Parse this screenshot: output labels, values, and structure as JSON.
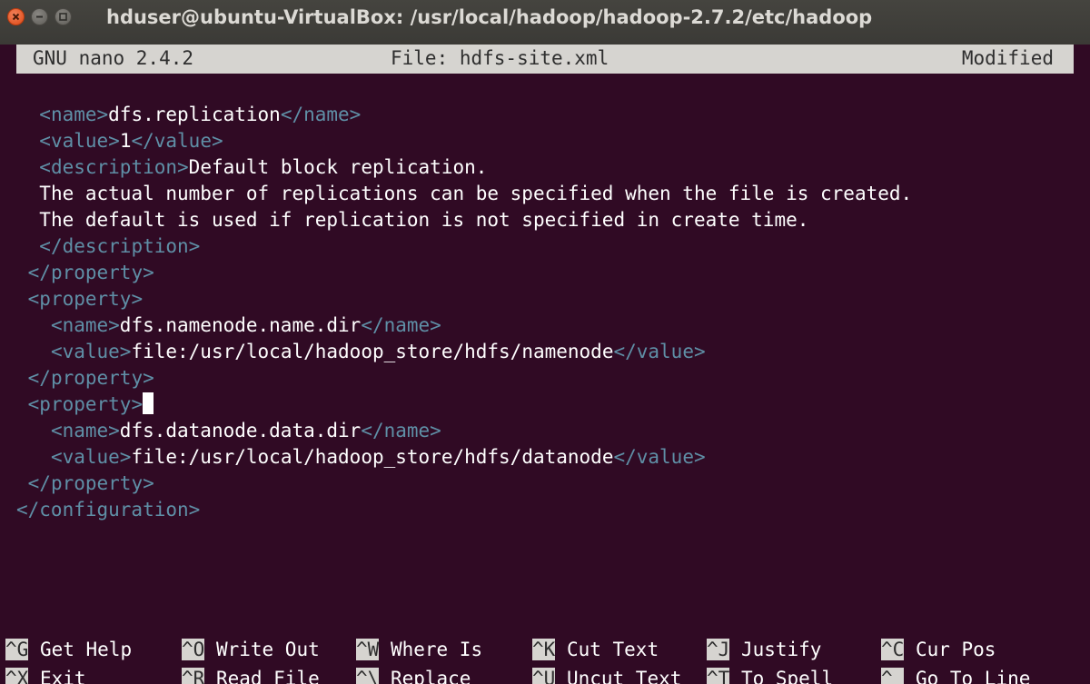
{
  "window": {
    "title": "hduser@ubuntu-VirtualBox: /usr/local/hadoop/hadoop-2.7.2/etc/hadoop"
  },
  "nano": {
    "version": "GNU nano 2.4.2",
    "file": "File: hdfs-site.xml",
    "status": "Modified"
  },
  "lines": [
    {
      "indent": "  ",
      "open": "<name>",
      "text": "dfs.replication",
      "close": "</name>"
    },
    {
      "indent": "  ",
      "open": "<value>",
      "text": "1",
      "close": "</value>"
    },
    {
      "indent": "  ",
      "open": "<description>",
      "text": "Default block replication.",
      "close": ""
    },
    {
      "indent": "  ",
      "open": "",
      "text": "The actual number of replications can be specified when the file is created.",
      "close": ""
    },
    {
      "indent": "  ",
      "open": "",
      "text": "The default is used if replication is not specified in create time.",
      "close": ""
    },
    {
      "indent": "  ",
      "open": "</description>",
      "text": "",
      "close": ""
    },
    {
      "indent": " ",
      "open": "</property>",
      "text": "",
      "close": ""
    },
    {
      "indent": " ",
      "open": "<property>",
      "text": "",
      "close": ""
    },
    {
      "indent": "   ",
      "open": "<name>",
      "text": "dfs.namenode.name.dir",
      "close": "</name>"
    },
    {
      "indent": "   ",
      "open": "<value>",
      "text": "file:/usr/local/hadoop_store/hdfs/namenode",
      "close": "</value>"
    },
    {
      "indent": " ",
      "open": "</property>",
      "text": "",
      "close": ""
    },
    {
      "indent": " ",
      "open": "<property>",
      "text": "",
      "close": "",
      "cursor": true
    },
    {
      "indent": "   ",
      "open": "<name>",
      "text": "dfs.datanode.data.dir",
      "close": "</name>"
    },
    {
      "indent": "   ",
      "open": "<value>",
      "text": "file:/usr/local/hadoop_store/hdfs/datanode",
      "close": "</value>"
    },
    {
      "indent": " ",
      "open": "</property>",
      "text": "",
      "close": ""
    },
    {
      "indent": "",
      "open": "</configuration>",
      "text": "",
      "close": ""
    }
  ],
  "shortcuts": [
    [
      {
        "key": "^G",
        "label": "Get Help"
      },
      {
        "key": "^O",
        "label": "Write Out"
      },
      {
        "key": "^W",
        "label": "Where Is"
      },
      {
        "key": "^K",
        "label": "Cut Text"
      },
      {
        "key": "^J",
        "label": "Justify"
      },
      {
        "key": "^C",
        "label": "Cur Pos"
      }
    ],
    [
      {
        "key": "^X",
        "label": "Exit"
      },
      {
        "key": "^R",
        "label": "Read File"
      },
      {
        "key": "^\\",
        "label": "Replace"
      },
      {
        "key": "^U",
        "label": "Uncut Text"
      },
      {
        "key": "^T",
        "label": "To Spell"
      },
      {
        "key": "^_",
        "label": "Go To Line"
      }
    ]
  ]
}
